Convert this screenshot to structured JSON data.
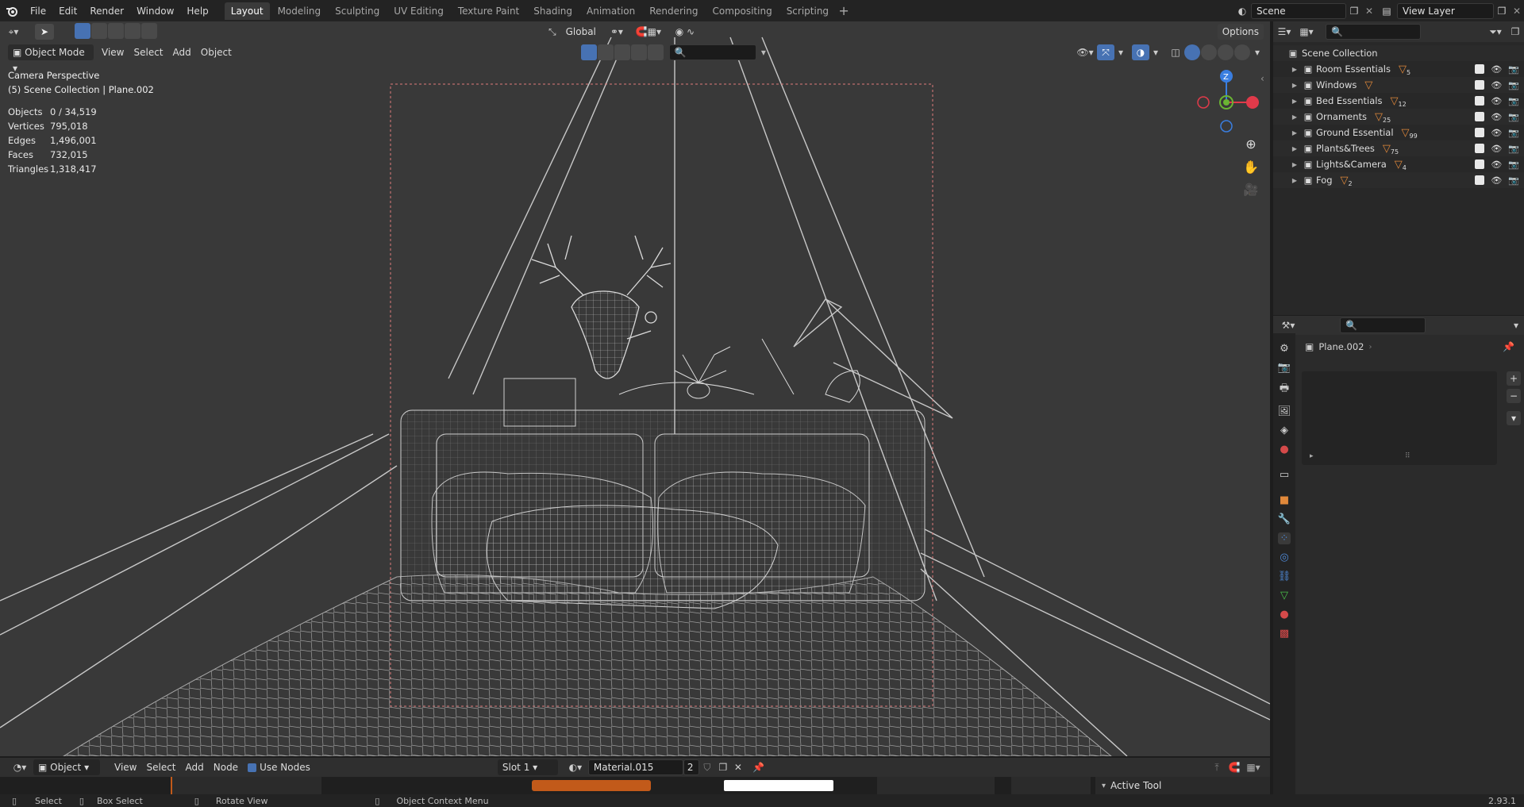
{
  "menus": [
    "File",
    "Edit",
    "Render",
    "Window",
    "Help"
  ],
  "workspace_tabs": [
    "Layout",
    "Modeling",
    "Sculpting",
    "UV Editing",
    "Texture Paint",
    "Shading",
    "Animation",
    "Rendering",
    "Compositing",
    "Scripting"
  ],
  "active_workspace": "Layout",
  "scene": {
    "name": "Scene",
    "view_layer": "View Layer"
  },
  "viewport": {
    "mode": "Object Mode",
    "menus": [
      "View",
      "Select",
      "Add",
      "Object"
    ],
    "orientation": "Global",
    "options_label": "Options",
    "info_line1": "Camera Perspective",
    "info_line2": "(5) Scene Collection | Plane.002",
    "stats": [
      {
        "label": "Objects",
        "value": "0 / 34,519"
      },
      {
        "label": "Vertices",
        "value": "795,018"
      },
      {
        "label": "Edges",
        "value": "1,496,001"
      },
      {
        "label": "Faces",
        "value": "732,015"
      },
      {
        "label": "Triangles",
        "value": "1,318,417"
      }
    ],
    "gizmo": {
      "z": "Z"
    }
  },
  "outliner": {
    "root": "Scene Collection",
    "collections": [
      {
        "name": "Room Essentials",
        "count": "5"
      },
      {
        "name": "Windows",
        "count": ""
      },
      {
        "name": "Bed Essentials",
        "count": "12"
      },
      {
        "name": "Ornaments",
        "count": "25"
      },
      {
        "name": "Ground Essential",
        "count": "99"
      },
      {
        "name": "Plants&Trees",
        "count": "75"
      },
      {
        "name": "Lights&Camera",
        "count": "4"
      },
      {
        "name": "Fog",
        "count": "2"
      }
    ]
  },
  "properties": {
    "object_name": "Plane.002"
  },
  "node_editor": {
    "type": "Object",
    "menus": [
      "View",
      "Select",
      "Add",
      "Node"
    ],
    "use_nodes_label": "Use Nodes",
    "slot": "Slot 1",
    "material": "Material.015",
    "users": "2",
    "active_tool": "Active Tool"
  },
  "statusbar": {
    "select": "Select",
    "box_select": "Box Select",
    "rotate_view": "Rotate View",
    "context_menu": "Object Context Menu",
    "version": "2.93.1"
  },
  "colors": {
    "accent": "#4772b3",
    "collection_icon": "#e0883a",
    "x_axis": "#e03a4a",
    "y_axis": "#6ab533",
    "z_axis": "#3a7ee0"
  }
}
